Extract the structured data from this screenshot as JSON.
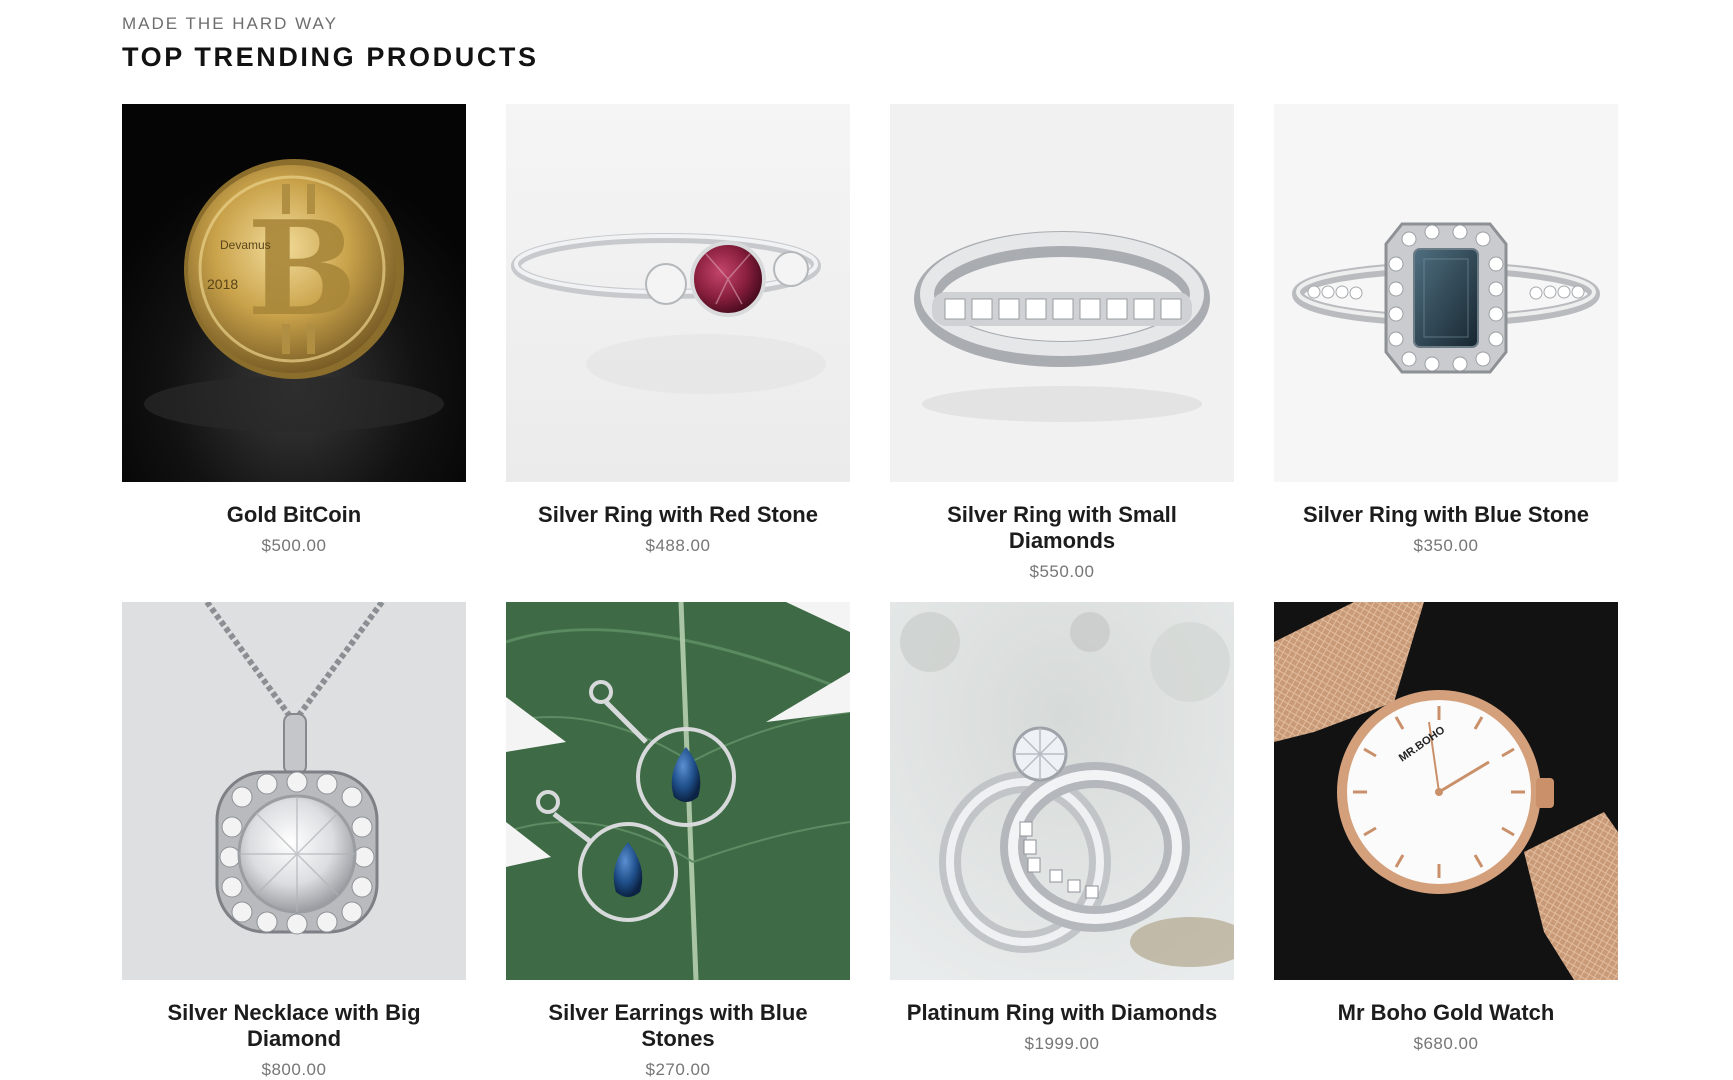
{
  "section": {
    "eyebrow": "MADE THE HARD WAY",
    "title": "TOP TRENDING PRODUCTS"
  },
  "products": [
    {
      "name": "Gold BitCoin",
      "price": "$500.00",
      "image": "gold-bitcoin-image"
    },
    {
      "name": "Silver Ring with Red Stone",
      "price": "$488.00",
      "image": "ring-red-stone-image"
    },
    {
      "name": "Silver Ring with Small Diamonds",
      "price": "$550.00",
      "image": "ring-small-diamonds-image"
    },
    {
      "name": "Silver Ring with Blue Stone",
      "price": "$350.00",
      "image": "ring-blue-stone-image"
    },
    {
      "name": "Silver Necklace with Big Diamond",
      "price": "$800.00",
      "image": "necklace-diamond-image"
    },
    {
      "name": "Silver Earrings with Blue Stones",
      "price": "$270.00",
      "image": "earrings-blue-stones-image"
    },
    {
      "name": "Platinum Ring with Diamonds",
      "price": "$1999.00",
      "image": "platinum-ring-image"
    },
    {
      "name": "Mr Boho Gold Watch",
      "price": "$680.00",
      "image": "gold-watch-image"
    }
  ],
  "colors": {
    "title": "#121212",
    "eyebrow": "#6e6e6e",
    "price": "#767676",
    "gold": "#c9a24a",
    "silver": "#d4d6d8",
    "ruby": "#8a1f3e",
    "sapphire": "#1f4f8a",
    "leaf": "#3e6b45",
    "rose_gold": "#d4a07c"
  },
  "logo_text": {
    "coin_brand": "Devamus",
    "coin_year": "2018",
    "watch_brand": "MR.BOHO"
  }
}
